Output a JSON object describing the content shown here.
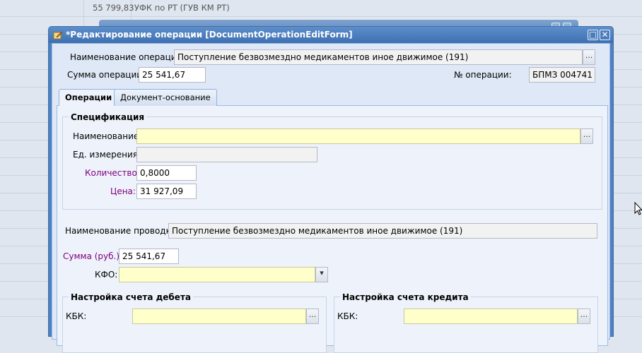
{
  "background": {
    "amount": "55 799,83",
    "payee": "УФК по РТ (ГУВ КМ РТ)"
  },
  "window": {
    "title": "*Редактирование операции [DocumentOperationEditForm]",
    "maximize_glyph": "□",
    "close_glyph": "✕"
  },
  "header": {
    "operation_name_label": "Наименование операции:",
    "operation_name_value": "Поступление безвозмездно медикаментов иное движимое (191)",
    "operation_sum_label": "Сумма операции:",
    "operation_sum_value": "25 541,67",
    "operation_no_label": "№ операции:",
    "operation_no_value": "БПМЗ 004741"
  },
  "tabs": [
    {
      "label": "Операции",
      "active": true
    },
    {
      "label": "Документ-основание",
      "active": false
    }
  ],
  "spec": {
    "legend": "Спецификация",
    "name_label": "Наименование:",
    "name_value": "",
    "unit_label": "Ед. измерения:",
    "unit_value": "",
    "qty_label": "Количество:",
    "qty_value": "0,8000",
    "price_label": "Цена:",
    "price_value": "31 927,09"
  },
  "posting": {
    "name_label": "Наименование проводки:",
    "name_value": "Поступление безвозмездно медикаментов иное движимое (191)",
    "sum_label": "Сумма (руб.):",
    "sum_value": "25 541,67",
    "kfo_label": "КФО:",
    "kfo_value": ""
  },
  "debit": {
    "legend": "Настройка счета дебета",
    "kbk_label": "КБК:",
    "kbk_value": ""
  },
  "credit": {
    "legend": "Настройка счета кредита",
    "kbk_label": "КБК:",
    "kbk_value": ""
  },
  "ui": {
    "ellipsis": "...",
    "dropdown": "▾"
  },
  "colors": {
    "title_bar": "#3e70b1",
    "required_label": "#800080",
    "required_field": "#ffffcc"
  }
}
